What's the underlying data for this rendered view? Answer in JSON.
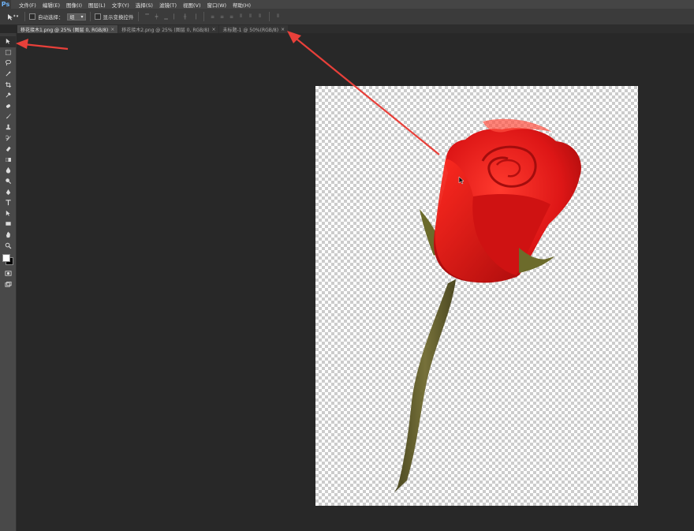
{
  "app": {
    "logo": "Ps"
  },
  "menu": [
    "文件(F)",
    "编辑(E)",
    "图像(I)",
    "图层(L)",
    "文字(Y)",
    "选择(S)",
    "滤镜(T)",
    "视图(V)",
    "窗口(W)",
    "帮助(H)"
  ],
  "options": {
    "auto_select_label": "自动选择：",
    "auto_select_value": "组",
    "show_transform_label": "显示变换控件"
  },
  "tabs": [
    {
      "label": "移花接木1.png @ 25% (图层 0, RGB/8)",
      "close": "×",
      "active": true
    },
    {
      "label": "移花接木2.png @ 25% (图层 0, RGB/8)",
      "close": "×",
      "active": false
    },
    {
      "label": "未标题-1 @ 50%(RGB/8)",
      "close": "×",
      "active": false
    }
  ],
  "tools": [
    "move-tool-icon",
    "marquee-tool-icon",
    "lasso-tool-icon",
    "magic-wand-icon",
    "crop-tool-icon",
    "eyedropper-icon",
    "healing-brush-icon",
    "brush-tool-icon",
    "clone-stamp-icon",
    "history-brush-icon",
    "eraser-icon",
    "gradient-tool-icon",
    "blur-tool-icon",
    "dodge-tool-icon",
    "pen-tool-icon",
    "type-tool-icon",
    "path-select-icon",
    "rectangle-tool-icon",
    "hand-tool-icon",
    "zoom-tool-icon"
  ],
  "colors": {
    "arrow": "#e8403a",
    "rose_red": "#d8181c",
    "stem": "#5d5a2c",
    "ps_blue": "#6fb3f7"
  }
}
